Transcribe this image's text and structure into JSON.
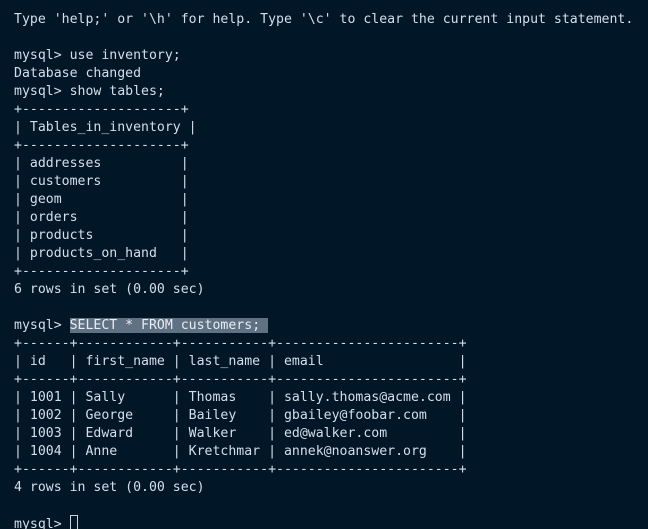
{
  "terminal": {
    "background_color": "#011627",
    "foreground_color": "#d6deeb",
    "selection_color": "#5f7182",
    "cursor_color": "#c9d4de",
    "prompt": "mysql> "
  },
  "lines": [
    {
      "id": "help-banner",
      "name": "help-banner-line",
      "text": "Type 'help;' or '\\h' for help. Type '\\c' to clear the current input statement."
    },
    {
      "id": "blank-1",
      "name": "blank-line",
      "text": ""
    },
    {
      "id": "cmd-use",
      "name": "command-line-use-inventory",
      "text": "mysql> use inventory;"
    },
    {
      "id": "out-dbchanged",
      "name": "output-database-changed",
      "text": "Database changed"
    },
    {
      "id": "cmd-show-tables",
      "name": "command-line-show-tables",
      "text": "mysql> show tables;"
    },
    {
      "id": "tbl1-top",
      "name": "tables-border-top",
      "text": "+--------------------+"
    },
    {
      "id": "tbl1-head",
      "name": "tables-header-row",
      "text": "| Tables_in_inventory |"
    },
    {
      "id": "tbl1-sep",
      "name": "tables-border-header",
      "text": "+--------------------+"
    },
    {
      "id": "tbl1-r1",
      "name": "tables-row-addresses",
      "text": "| addresses          |"
    },
    {
      "id": "tbl1-r2",
      "name": "tables-row-customers",
      "text": "| customers          |"
    },
    {
      "id": "tbl1-r3",
      "name": "tables-row-geom",
      "text": "| geom               |"
    },
    {
      "id": "tbl1-r4",
      "name": "tables-row-orders",
      "text": "| orders             |"
    },
    {
      "id": "tbl1-r5",
      "name": "tables-row-products",
      "text": "| products           |"
    },
    {
      "id": "tbl1-r6",
      "name": "tables-row-products-on-hand",
      "text": "| products_on_hand   |"
    },
    {
      "id": "tbl1-bot",
      "name": "tables-border-bottom",
      "text": "+--------------------+"
    },
    {
      "id": "tbl1-count",
      "name": "tables-rowcount-status",
      "text": "6 rows in set (0.00 sec)"
    },
    {
      "id": "blank-2",
      "name": "blank-line",
      "text": ""
    },
    {
      "id": "cmd-select",
      "name": "command-line-select-customers",
      "prompt": "mysql> ",
      "selected_text": "SELECT * FROM customers; "
    },
    {
      "id": "tbl2-top",
      "name": "customers-border-top",
      "text": "+------+------------+-----------+-----------------------+"
    },
    {
      "id": "tbl2-head",
      "name": "customers-header-row",
      "text": "| id   | first_name | last_name | email                 |"
    },
    {
      "id": "tbl2-sep",
      "name": "customers-border-header",
      "text": "+------+------------+-----------+-----------------------+"
    },
    {
      "id": "tbl2-r1",
      "name": "customers-row-1001",
      "text": "| 1001 | Sally      | Thomas    | sally.thomas@acme.com |"
    },
    {
      "id": "tbl2-r2",
      "name": "customers-row-1002",
      "text": "| 1002 | George     | Bailey    | gbailey@foobar.com    |"
    },
    {
      "id": "tbl2-r3",
      "name": "customers-row-1003",
      "text": "| 1003 | Edward     | Walker    | ed@walker.com         |"
    },
    {
      "id": "tbl2-r4",
      "name": "customers-row-1004",
      "text": "| 1004 | Anne       | Kretchmar | annek@noanswer.org    |"
    },
    {
      "id": "tbl2-bot",
      "name": "customers-border-bottom",
      "text": "+------+------------+-----------+-----------------------+"
    },
    {
      "id": "tbl2-count",
      "name": "customers-rowcount-status",
      "text": "4 rows in set (0.00 sec)"
    },
    {
      "id": "blank-3",
      "name": "blank-line",
      "text": ""
    },
    {
      "id": "cmd-final",
      "name": "command-line-active-prompt",
      "prompt": "mysql> ",
      "cursor": true
    }
  ],
  "tables_in_inventory": {
    "column": "Tables_in_inventory",
    "rows": [
      "addresses",
      "customers",
      "geom",
      "orders",
      "products",
      "products_on_hand"
    ],
    "row_count": 6,
    "duration": "0.00 sec"
  },
  "customers": {
    "columns": [
      "id",
      "first_name",
      "last_name",
      "email"
    ],
    "rows": [
      [
        "1001",
        "Sally",
        "Thomas",
        "sally.thomas@acme.com"
      ],
      [
        "1002",
        "George",
        "Bailey",
        "gbailey@foobar.com"
      ],
      [
        "1003",
        "Edward",
        "Walker",
        "ed@walker.com"
      ],
      [
        "1004",
        "Anne",
        "Kretchmar",
        "annek@noanswer.org"
      ]
    ],
    "row_count": 4,
    "duration": "0.00 sec"
  }
}
